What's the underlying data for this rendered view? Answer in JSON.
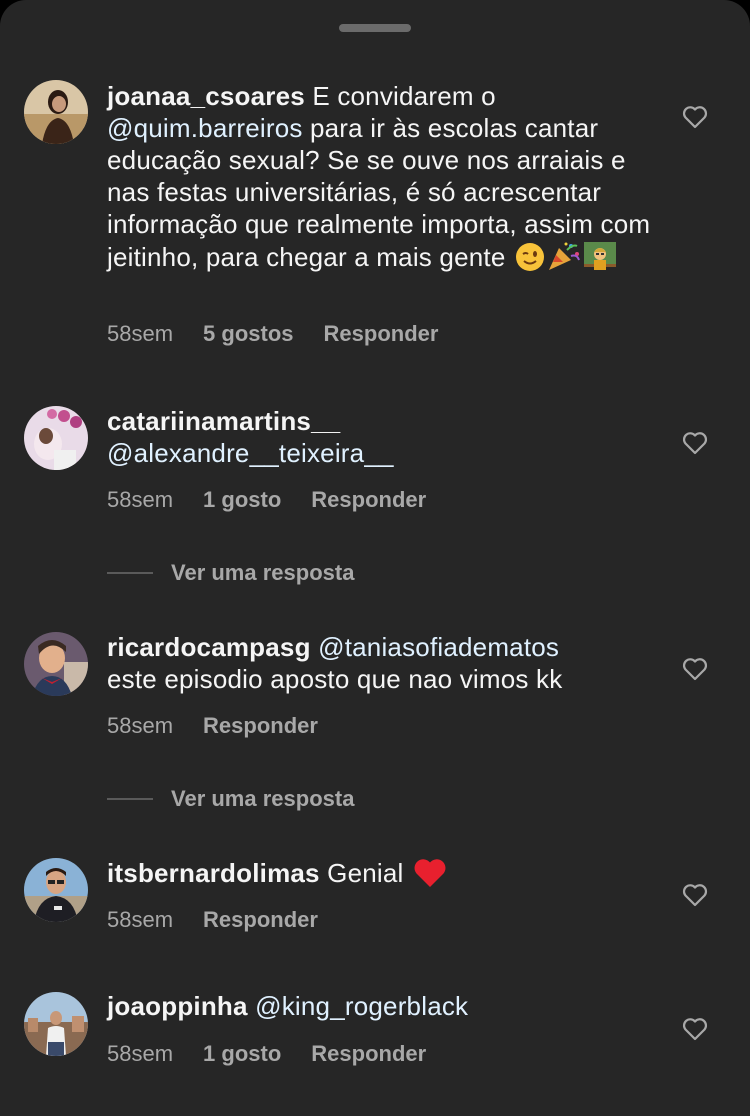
{
  "comments": [
    {
      "username": "joanaa_csoares",
      "text_before": " E convidarem o",
      "mention": "@quim.barreiros",
      "text_after": " para ir às escolas cantar educação sexual? Se se ouve nos arraiais e nas festas universitárias, é só acrescentar informação que realmente importa, assim com jeitinho, para chegar a mais gente ",
      "emojis": [
        "winking-face",
        "party-popper",
        "teacher"
      ],
      "time": "58sem",
      "likes": "5 gostos",
      "reply": "Responder"
    },
    {
      "username": "catariinamartins__",
      "mention": "@alexandre__teixeira__",
      "time": "58sem",
      "likes": "1 gosto",
      "reply": "Responder",
      "view_replies": "Ver uma resposta"
    },
    {
      "username": "ricardocampasg",
      "mention": "@taniasofiadematos",
      "text_after": "este episodio aposto que nao vimos kk",
      "time": "58sem",
      "reply": "Responder",
      "view_replies": "Ver uma resposta"
    },
    {
      "username": "itsbernardolimas",
      "text_before": " Genial ",
      "emojis": [
        "red-heart"
      ],
      "time": "58sem",
      "reply": "Responder"
    },
    {
      "username": "joaoppinha",
      "mention": "@king_rogerblack",
      "time": "58sem",
      "likes": "1 gosto",
      "reply": "Responder"
    }
  ],
  "colors": {
    "background": "#262626",
    "text": "#f5f5f5",
    "secondary": "#a8a8a8",
    "mention": "#e0f1ff"
  }
}
